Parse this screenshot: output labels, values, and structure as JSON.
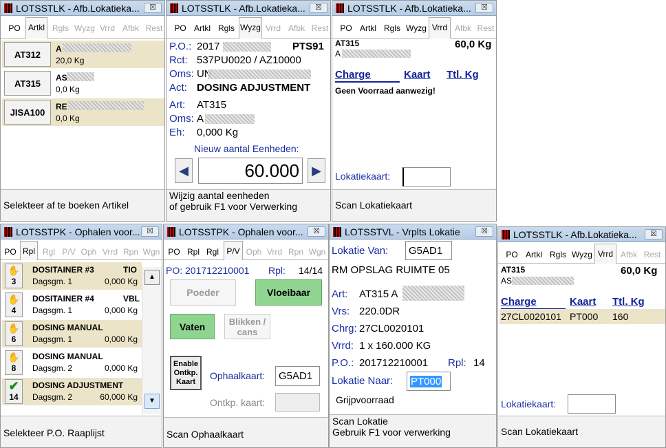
{
  "w1": {
    "title": "LOTSSTLK - Afb.Lokatieka...",
    "close": "☒",
    "tabs": [
      "PO",
      "Artkl",
      "Rgls",
      "Wyzg",
      "Vrrd",
      "Afbk",
      "Rest"
    ],
    "items": [
      {
        "code": "AT312",
        "name": "A",
        "qty": "20,0 Kg"
      },
      {
        "code": "AT315",
        "name": "AS",
        "qty": "0,0 Kg"
      },
      {
        "code": "JISA100",
        "name": "RE",
        "qty": "0,0 Kg"
      }
    ],
    "footer": "Selekteer af te boeken Artikel"
  },
  "w2": {
    "title": "LOTSSTLK - Afb.Lokatieka...",
    "close": "☒",
    "tabs": [
      "PO",
      "Artkl",
      "Rgls",
      "Wyzg",
      "Vrrd",
      "Afbk",
      "Rest"
    ],
    "po_label": "P.O.:",
    "po_value": "2017",
    "po_code": "PTS91",
    "rct_label": "Rct:",
    "rct_value": "537PU0020 / AZ10000",
    "oms_label": "Oms:",
    "oms_value": "UN",
    "act_label": "Act:",
    "act_value": "DOSING ADJUSTMENT",
    "art_label": "Art:",
    "art_value": "AT315",
    "oms2_label": "Oms:",
    "oms2_value": "A",
    "eh_label": "Eh:",
    "eh_value": "0,000 Kg",
    "new_label": "Nieuw aantal Eenheden:",
    "new_value": "60.000",
    "footer1": "Wijzig aantal eenheden",
    "footer2": "of gebruik F1 voor Verwerking"
  },
  "w3": {
    "title": "LOTSSTLK - Afb.Lokatieka...",
    "close": "☒",
    "tabs": [
      "PO",
      "Artkl",
      "Rgls",
      "Wyzg",
      "Vrrd",
      "Afbk",
      "Rest"
    ],
    "art": "AT315",
    "art2": "A",
    "qty": "60,0 Kg",
    "h_charge": "Charge",
    "h_kaart": "Kaart",
    "h_ttl": "Ttl. Kg",
    "msg": "Geen Voorraad aanwezig!",
    "lok_label": "Lokatiekaart:",
    "lok_value": "",
    "footer": "Scan Lokatiekaart"
  },
  "w4": {
    "title": "LOTSSTPK - Ophalen voor...",
    "close": "☒",
    "tabs": [
      "PO",
      "Rpl",
      "Rgl",
      "P/V",
      "Oph",
      "Vrrd",
      "Rpn",
      "Wgn"
    ],
    "items": [
      {
        "num": "3",
        "name": "DOSITAINER #3",
        "tag": "TIO",
        "sub": "Dagsgm. 1",
        "qty": "0,000 Kg",
        "hl": true,
        "check": false
      },
      {
        "num": "4",
        "name": "DOSITAINER #4",
        "tag": "VBL",
        "sub": "Dagsgm. 1",
        "qty": "0,000 Kg",
        "hl": false,
        "check": false
      },
      {
        "num": "6",
        "name": "DOSING MANUAL",
        "tag": "",
        "sub": "Dagsgm. 1",
        "qty": "0,000 Kg",
        "hl": true,
        "check": false
      },
      {
        "num": "8",
        "name": "DOSING MANUAL",
        "tag": "",
        "sub": "Dagsgm. 2",
        "qty": "0,000 Kg",
        "hl": false,
        "check": false
      },
      {
        "num": "14",
        "name": "DOSING ADJUSTMENT",
        "tag": "",
        "sub": "Dagsgm. 2",
        "qty": "60,000 Kg",
        "hl": true,
        "check": true
      }
    ],
    "footer": "Selekteer P.O. Raaplijst"
  },
  "w5": {
    "title": "LOTSSTPK - Ophalen voor...",
    "close": "☒",
    "tabs": [
      "PO",
      "Rpl",
      "Rgl",
      "P/V",
      "Oph",
      "Vrrd",
      "Rpn",
      "Wgn"
    ],
    "po": "PO: 201712210001",
    "rpl_label": "Rpl:",
    "rpl_value": "14/14",
    "poeder": "Poeder",
    "vloeibaar": "Vloeibaar",
    "vaten": "Vaten",
    "blikken": "Blikken / cans",
    "enable": "Enable Ontkp. Kaart",
    "oph_label": "Ophaalkaart:",
    "oph_value": "G5AD1",
    "ontkp_label": "Ontkp. kaart:",
    "ontkp_value": "",
    "footer": "Scan Ophaalkaart"
  },
  "w6": {
    "title": "LOTSSTVL - Vrplts Lokatie",
    "close": "☒",
    "van_label": "Lokatie Van:",
    "van_value": "G5AD1",
    "ruimte": "RM OPSLAG RUIMTE 05",
    "art_label": "Art:",
    "art_value": "AT315 A",
    "vrs_label": "Vrs:",
    "vrs_value": "220.0DR",
    "chrg_label": "Chrg:",
    "chrg_value": "27CL0020101",
    "vrrd_label": "Vrrd:",
    "vrrd_value": "1 x 160.000 KG",
    "po_label": "P.O.:",
    "po_value": "201712210001",
    "rpl_label": "Rpl:",
    "rpl_value": "14",
    "naar_label": "Lokatie Naar:",
    "naar_value": "PT000",
    "grijp": "Grijpvoorraad",
    "footer1": "Scan Lokatie",
    "footer2": "Gebruik F1 voor verwerking"
  },
  "w7": {
    "title": "LOTSSTLK - Afb.Lokatieka...",
    "close": "☒",
    "tabs": [
      "PO",
      "Artkl",
      "Rgls",
      "Wyzg",
      "Vrrd",
      "Afbk",
      "Rest"
    ],
    "art": "AT315",
    "art2": "AS",
    "qty": "60,0 Kg",
    "h_charge": "Charge",
    "h_kaart": "Kaart",
    "h_ttl": "Ttl. Kg",
    "row": {
      "charge": "27CL0020101",
      "kaart": "PT000",
      "ttl": "160"
    },
    "lok_label": "Lokatiekaart:",
    "lok_value": "",
    "footer": "Scan Lokatiekaart"
  }
}
